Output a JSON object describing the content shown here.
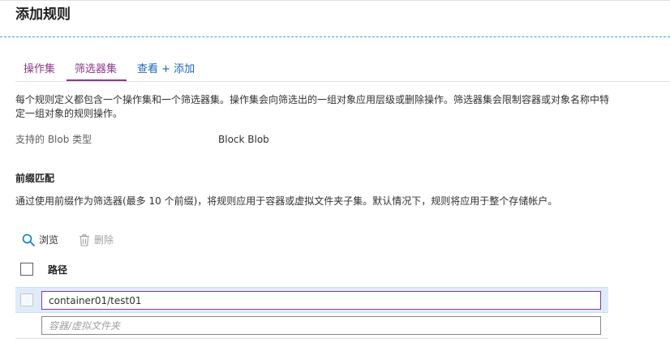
{
  "page": {
    "title": "添加规则"
  },
  "tabs": [
    {
      "label": "操作集"
    },
    {
      "label": "筛选器集"
    },
    {
      "label": "查看 + 添加"
    }
  ],
  "description": "每个规则定义都包含一个操作集和一个筛选器集。操作集会向筛选出的一组对象应用层级或删除操作。筛选器集会限制容器或对象名称中特定一组对象的规则操作。",
  "blob_types": {
    "label": "支持的 Blob 类型",
    "value": "Block Blob"
  },
  "prefix_match": {
    "title": "前缀匹配",
    "description": "通过使用前缀作为筛选器(最多 10 个前缀)，将规则应用于容器或虚拟文件夹子集。默认情况下，规则将应用于整个存储帐户。"
  },
  "toolbar": {
    "browse_label": "浏览",
    "delete_label": "删除"
  },
  "grid": {
    "column_header": "路径",
    "rows": [
      {
        "value": "container01/test01",
        "placeholder": ""
      },
      {
        "value": "",
        "placeholder": "容器/虚拟文件夹"
      }
    ]
  },
  "colors": {
    "tab_active": "#8a3a8a",
    "link": "#1a66b8",
    "selected_row": "#deecf9",
    "dashed_separator": "#3aa6c7"
  }
}
